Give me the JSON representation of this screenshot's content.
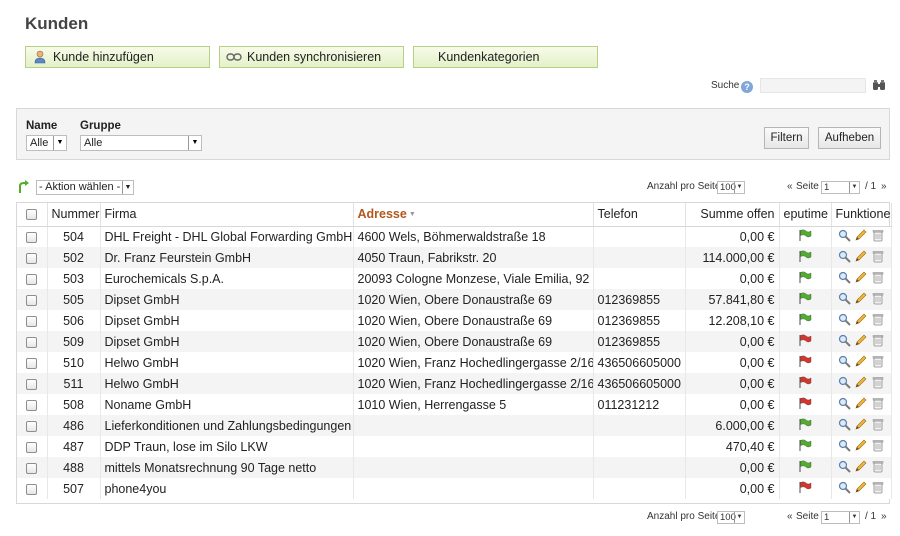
{
  "page": {
    "title": "Kunden"
  },
  "toolbar": {
    "add_customer": "Kunde hinzufügen",
    "sync_customers": "Kunden synchronisieren",
    "categories": "Kundenkategorien"
  },
  "search": {
    "label": "Suche",
    "help": "?",
    "value": ""
  },
  "filter": {
    "name_label": "Name",
    "name_value": "Alle",
    "group_label": "Gruppe",
    "group_value": "Alle",
    "filter_button": "Filtern",
    "reset_button": "Aufheben"
  },
  "actions": {
    "select_value": "- Aktion wählen -"
  },
  "pager": {
    "per_page_label": "Anzahl pro Seite",
    "per_page_value": "100",
    "first": "«",
    "page_label": "Seite",
    "page_value": "1",
    "of": "/ 1",
    "last": "»"
  },
  "table": {
    "columns": {
      "number": "Nummer",
      "company": "Firma",
      "address": "Adresse",
      "phone": "Telefon",
      "balance": "Summe offen",
      "eputime": "eputime",
      "functions": "Funktionen"
    },
    "rows": [
      {
        "number": "504",
        "company": "DHL Freight - DHL Global Forwarding GmbH",
        "address": "4600 Wels, Böhmerwaldstraße 18",
        "phone": "",
        "balance": "0,00 €",
        "flag": "green"
      },
      {
        "number": "502",
        "company": "Dr. Franz Feurstein GmbH",
        "address": "4050 Traun, Fabrikstr. 20",
        "phone": "",
        "balance": "114.000,00 €",
        "flag": "green"
      },
      {
        "number": "503",
        "company": "Eurochemicals S.p.A.",
        "address": "20093 Cologne Monzese, Viale Emilia, 92",
        "phone": "",
        "balance": "0,00 €",
        "flag": "green"
      },
      {
        "number": "505",
        "company": "Dipset GmbH",
        "address": "1020 Wien, Obere Donaustraße 69",
        "phone": "012369855",
        "balance": "57.841,80 €",
        "flag": "green"
      },
      {
        "number": "506",
        "company": "Dipset GmbH",
        "address": "1020 Wien, Obere Donaustraße 69",
        "phone": "012369855",
        "balance": "12.208,10 €",
        "flag": "green"
      },
      {
        "number": "509",
        "company": "Dipset GmbH",
        "address": "1020 Wien, Obere Donaustraße 69",
        "phone": "012369855",
        "balance": "0,00 €",
        "flag": "red"
      },
      {
        "number": "510",
        "company": "Helwo GmbH",
        "address": "1020 Wien, Franz Hochedlingergasse 2/16",
        "phone": "436506605000",
        "balance": "0,00 €",
        "flag": "red"
      },
      {
        "number": "511",
        "company": "Helwo GmbH",
        "address": "1020 Wien, Franz Hochedlingergasse 2/16",
        "phone": "436506605000",
        "balance": "0,00 €",
        "flag": "red"
      },
      {
        "number": "508",
        "company": "Noname GmbH",
        "address": "1010 Wien, Herrengasse 5",
        "phone": "011231212",
        "balance": "0,00 €",
        "flag": "red"
      },
      {
        "number": "486",
        "company": "Lieferkonditionen und Zahlungsbedingungen",
        "address": "",
        "phone": "",
        "balance": "6.000,00 €",
        "flag": "green"
      },
      {
        "number": "487",
        "company": "DDP Traun, lose im Silo LKW",
        "address": "",
        "phone": "",
        "balance": "470,40 €",
        "flag": "green"
      },
      {
        "number": "488",
        "company": "mittels Monatsrechnung 90 Tage netto",
        "address": "",
        "phone": "",
        "balance": "0,00 €",
        "flag": "green"
      },
      {
        "number": "507",
        "company": "phone4you",
        "address": "",
        "phone": "",
        "balance": "0,00 €",
        "flag": "red"
      }
    ]
  },
  "colors": {
    "flag_green": "#4fae2c",
    "flag_red": "#d9342b",
    "sorted_header": "#b4561d",
    "button_green": "#e4f1c8"
  },
  "icons": {
    "add": "add-user-icon",
    "sync": "sync-icon",
    "search": "binoculars-icon",
    "view": "magnifier-icon",
    "edit": "pencil-icon",
    "delete": "trash-icon",
    "action": "arrow-curve-icon"
  }
}
